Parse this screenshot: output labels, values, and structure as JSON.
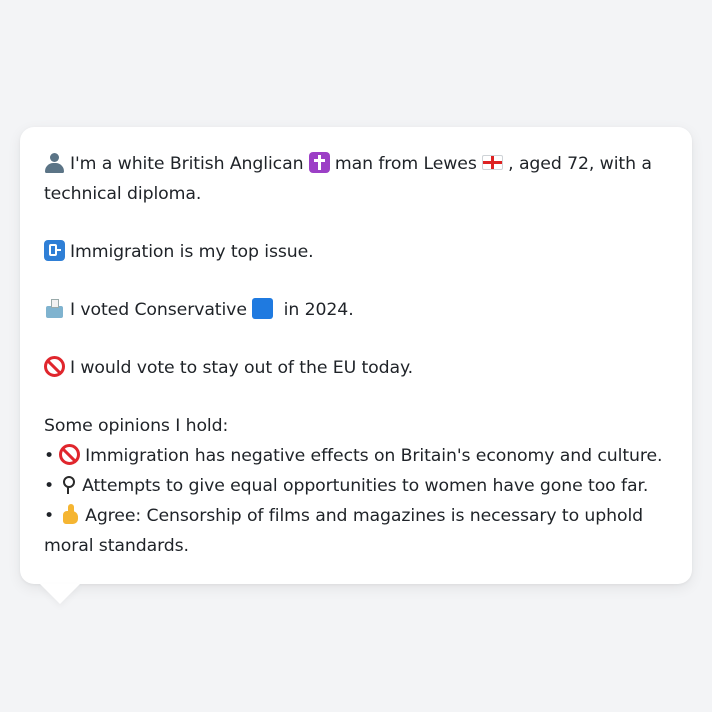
{
  "message": {
    "intro": {
      "part1": "I'm a white British Anglican",
      "part2": "man from Lewes",
      "part3": ", aged 72, with a technical diploma."
    },
    "top_issue": "Immigration is my top issue.",
    "vote": {
      "part1": "I voted Conservative",
      "part2": "in 2024."
    },
    "eu": "I would vote to stay out of the EU today.",
    "opinions_heading": "Some opinions I hold:",
    "bullet": "•",
    "opinions": [
      "Immigration has negative effects on Britain's economy and culture.",
      "Attempts to give equal opportunities to women have gone too far.",
      "Agree: Censorship of films and magazines is necessary to uphold moral standards."
    ]
  },
  "icons": {
    "person": "bust-in-silhouette-icon",
    "religion": "latin-cross-icon",
    "flag": "england-flag-icon",
    "issue": "passport-control-icon",
    "ballot": "ballot-box-icon",
    "party": "blue-square-icon",
    "eu": "prohibited-icon",
    "opinion1": "prohibited-icon",
    "opinion2": "female-sign-icon",
    "opinion3": "thumbs-up-icon"
  },
  "colors": {
    "background": "#f3f4f6",
    "bubble": "#ffffff",
    "text": "#1f2328",
    "party_blue": "#1f7ae0",
    "prohibited_red": "#e0262d"
  }
}
